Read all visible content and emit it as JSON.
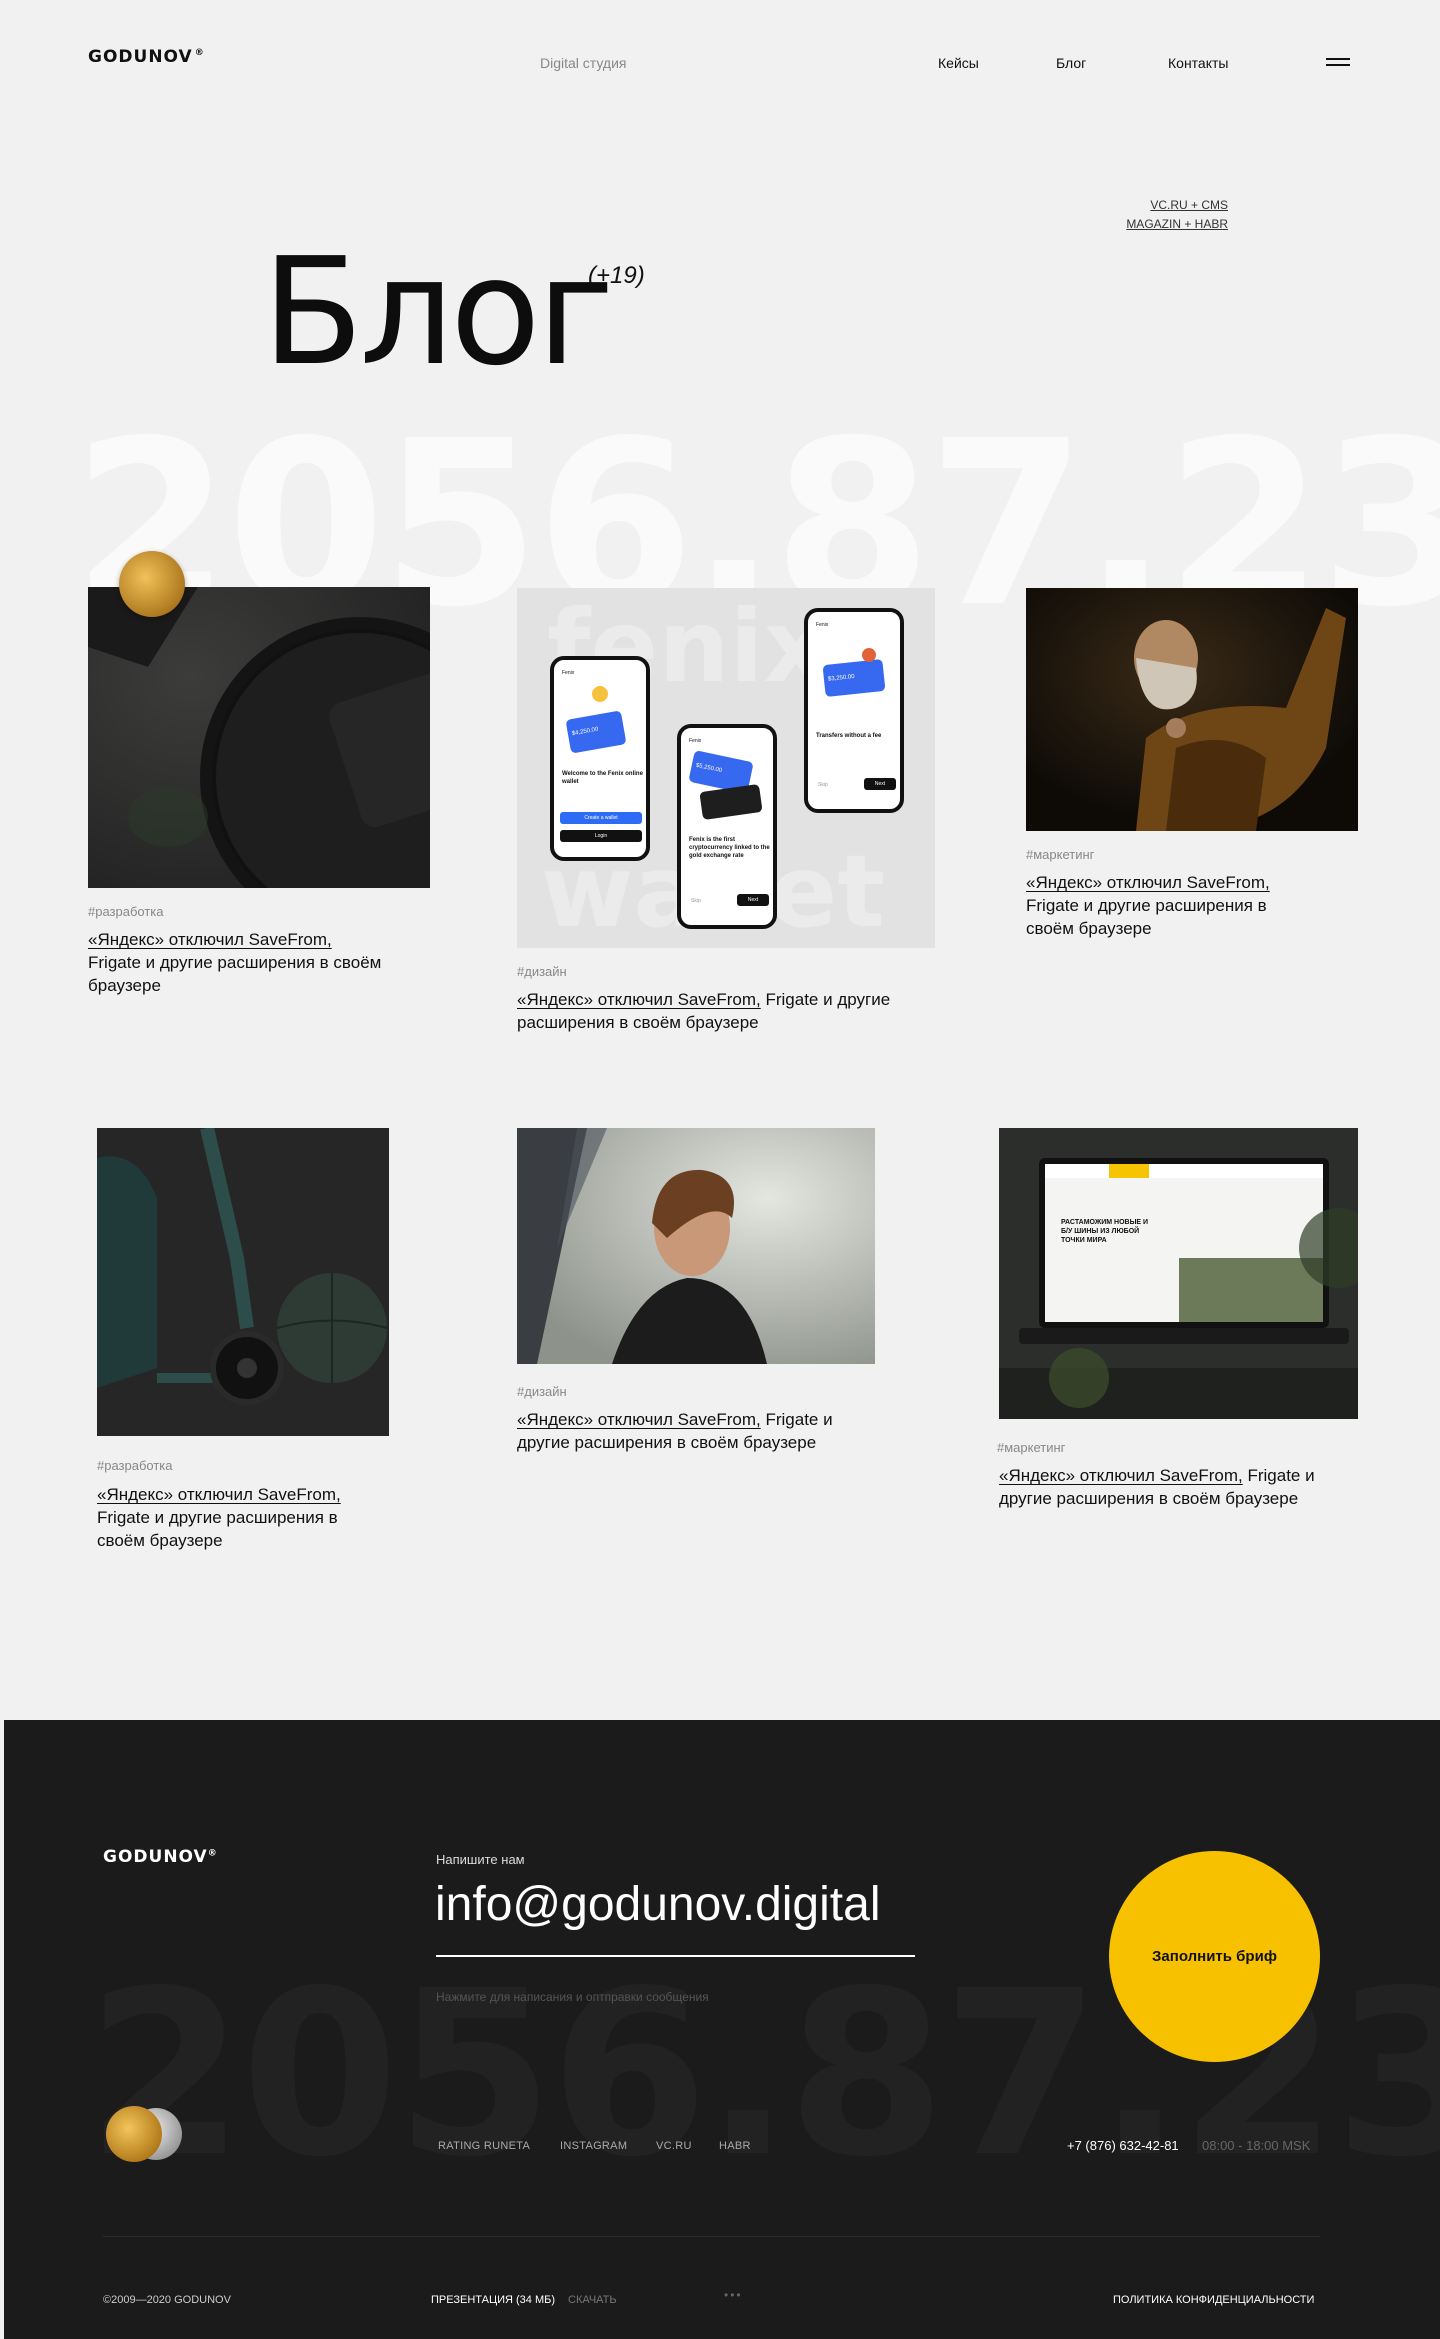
{
  "header": {
    "logo": "GODUNOV",
    "logo_mark": "®",
    "tagline": "Digital студия",
    "nav": [
      "Кейсы",
      "Блог",
      "Контакты"
    ],
    "menu_icon": "hamburger-icon"
  },
  "hero": {
    "title": "Блог",
    "count": "(+19)",
    "tags": [
      "VC.RU + CMS",
      "MAGAZIN + HABR"
    ],
    "bg_number": "2056.87.23"
  },
  "posts": [
    {
      "tag": "#разработка",
      "title_link": "«Яндекс» отключил SaveFrom,",
      "title_rest": "Frigate и другие расширения в своём браузере"
    },
    {
      "tag": "#дизайн",
      "title_link": "«Яндекс» отключил SaveFrom,",
      "title_rest": "Frigate и другие расширения в своём браузере"
    },
    {
      "tag": "#маркетинг",
      "title_link": "«Яндекс» отключил SaveFrom,",
      "title_rest": "Frigate и другие расширения в своём браузере"
    },
    {
      "tag": "#разработка",
      "title_link": "«Яндекс» отключил SaveFrom,",
      "title_rest": "Frigate и другие расширения в своём браузере"
    },
    {
      "tag": "#дизайн",
      "title_link": "«Яндекс» отключил SaveFrom,",
      "title_rest": "Frigate и другие расширения в своём браузере"
    },
    {
      "tag": "#маркетинг",
      "title_link": "«Яндекс» отключил SaveFrom,",
      "title_rest": "Frigate и другие расширения в своём браузере"
    }
  ],
  "phones": {
    "watermark_top": "fenix",
    "watermark_bottom": "wallet",
    "screen1": {
      "brand": "Fenix",
      "amount": "$4,250.00",
      "title": "Welcome to the Fenix online wallet",
      "btn1": "Create a wallet",
      "btn2": "Login"
    },
    "screen2": {
      "brand": "Fenix",
      "amount": "$5,250.00",
      "title": "Fenix is the first cryptocurrency linked to the gold exchange rate",
      "btn": "Next",
      "skip": "Skip"
    },
    "screen3": {
      "brand": "Fenix",
      "amount": "$3,250.00",
      "title": "Transfers without a fee",
      "btn": "Next",
      "skip": "Skip"
    }
  },
  "laptop": {
    "headline": "РАСТАМОЖИМ НОВЫЕ И Б/У ШИНЫ ИЗ ЛЮБОЙ ТОЧКИ МИРА"
  },
  "footer": {
    "logo": "GODUNOV",
    "logo_mark": "®",
    "write_label": "Напишите нам",
    "email": "info@godunov.digital",
    "hint": "Нажмите для написания и оптправки сообщения",
    "cta": "Заполнить бриф",
    "links": [
      "RATING RUNETA",
      "INSTAGRAM",
      "VC.RU",
      "HABR"
    ],
    "phone": "+7 (876) 632-42-81",
    "hours": "08:00 - 18:00 MSK",
    "bg_number": "2056.87.23",
    "copyright": "©2009—2020 GODUNOV",
    "presentation": "ПРЕЗЕНТАЦИЯ (34 МБ)",
    "download": "СКАЧАТЬ",
    "dots": "•••",
    "privacy": "ПОЛИТИКА КОНФИДЕНЦИАЛЬНОСТИ"
  }
}
